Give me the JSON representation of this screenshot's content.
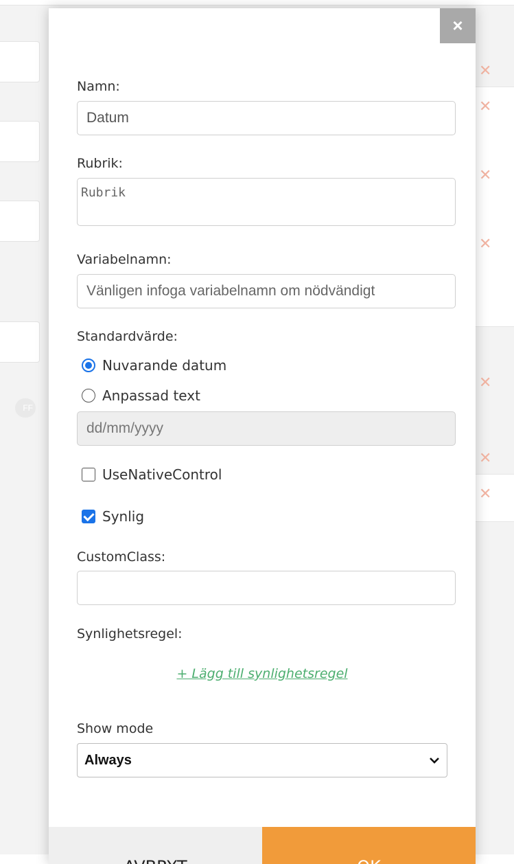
{
  "modal": {
    "close_symbol": "×",
    "name": {
      "label": "Namn:",
      "value": "Datum"
    },
    "heading": {
      "label": "Rubrik:",
      "placeholder": "Rubrik"
    },
    "variable": {
      "label": "Variabelnamn:",
      "placeholder": "Vänligen infoga variabelnamn om nödvändigt"
    },
    "default_value": {
      "label": "Standardvärde:",
      "options": [
        {
          "label": "Nuvarande datum",
          "checked": true
        },
        {
          "label": "Anpassad text",
          "checked": false
        }
      ],
      "date_placeholder": "dd/mm/yyyy"
    },
    "use_native_control": {
      "label": "UseNativeControl",
      "checked": false
    },
    "visible": {
      "label": "Synlig",
      "checked": true
    },
    "custom_class": {
      "label": "CustomClass:",
      "value": ""
    },
    "visibility_rule": {
      "label": "Synlighetsregel:",
      "add_link": "+ Lägg till synlighetsregel"
    },
    "show_mode": {
      "label": "Show mode",
      "selected": "Always"
    },
    "buttons": {
      "cancel": "AVBRYT",
      "ok": "OK"
    }
  },
  "background": {
    "toggle_text": "FF"
  },
  "colors": {
    "accent_blue": "#1a73e8",
    "ok_orange": "#f19b3a",
    "link_green": "#4cae6f",
    "close_gray": "#a9a9a9"
  }
}
